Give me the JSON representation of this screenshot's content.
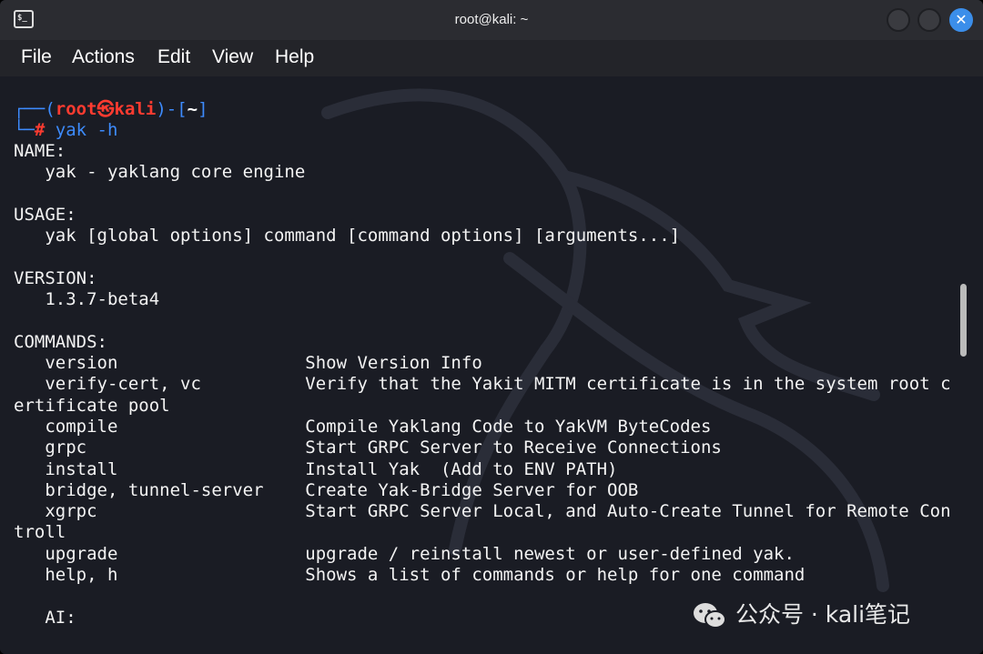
{
  "window": {
    "title": "root@kali: ~"
  },
  "menu": [
    "File",
    "Actions",
    "Edit",
    "View",
    "Help"
  ],
  "prompt": {
    "open": "┌──(",
    "user": "root",
    "at": "㉿",
    "host": "kali",
    "mid": ")-[",
    "path": "~",
    "close": "]",
    "corner": "└─",
    "hash": "#",
    "command": " yak -h"
  },
  "lines": [
    "NAME:",
    "   yak - yaklang core engine",
    "",
    "USAGE:",
    "   yak [global options] command [command options] [arguments...]",
    "",
    "VERSION:",
    "   1.3.7-beta4",
    "",
    "COMMANDS:",
    "   version                  Show Version Info",
    "   verify-cert, vc          Verify that the Yakit MITM certificate is in the system root c",
    "ertificate pool",
    "   compile                  Compile Yaklang Code to YakVM ByteCodes",
    "   grpc                     Start GRPC Server to Receive Connections",
    "   install                  Install Yak  (Add to ENV PATH)",
    "   bridge, tunnel-server    Create Yak-Bridge Server for OOB",
    "   xgrpc                    Start GRPC Server Local, and Auto-Create Tunnel for Remote Con",
    "troll",
    "   upgrade                  upgrade / reinstall newest or user-defined yak.",
    "   help, h                  Shows a list of commands or help for one command",
    "",
    "   AI:"
  ],
  "watermark": {
    "text": "公众号 · kali笔记"
  }
}
